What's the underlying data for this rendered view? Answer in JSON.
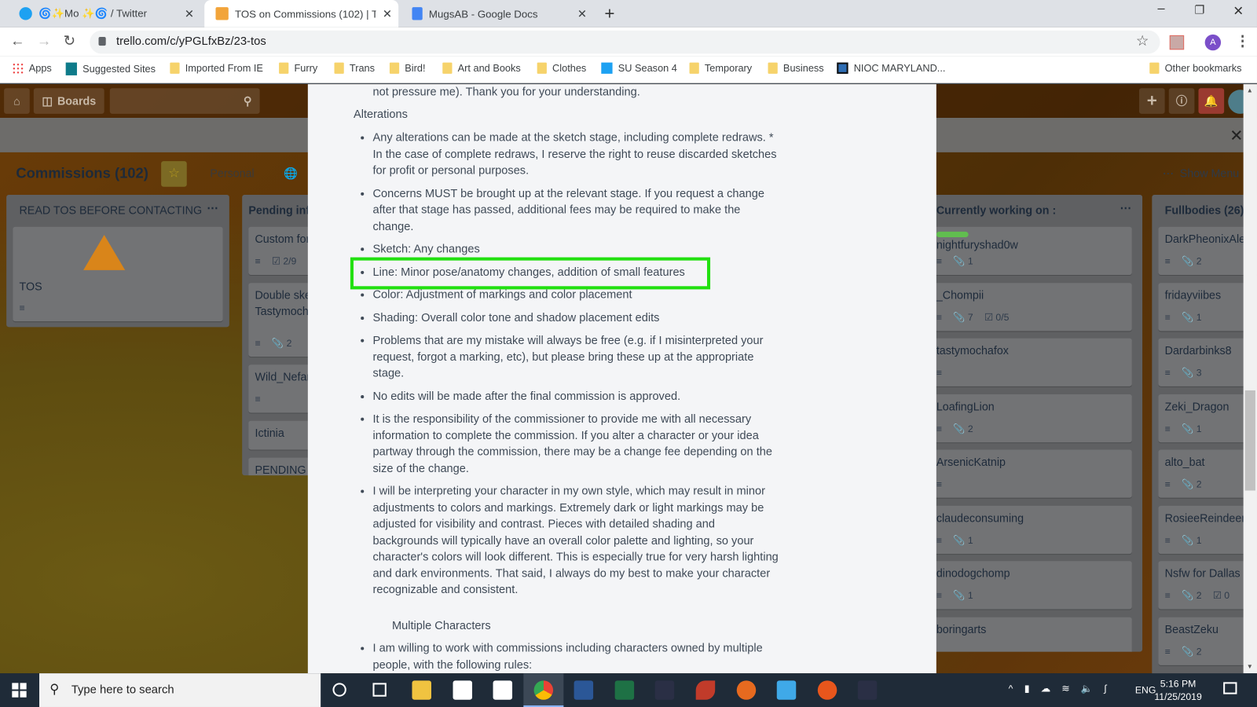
{
  "browser": {
    "tabs": [
      {
        "title": "🌀✨Mo ✨🌀 / Twitter",
        "icon": "twitter-icon"
      },
      {
        "title": "TOS on Commissions (102) | Trello",
        "icon": "trello-icon",
        "active": true
      },
      {
        "title": "MugsAB - Google Docs",
        "icon": "google-docs-icon"
      }
    ],
    "new_tab": "+",
    "close": "✕",
    "url": "trello.com/c/yPGLfxBz/23-tos",
    "profile_initial": "A",
    "bookmarks": [
      "Apps",
      "Suggested Sites",
      "Imported From IE",
      "Furry",
      "Trans",
      "Bird!",
      "Art and Books",
      "Clothes",
      "SU Season 4",
      "Temporary",
      "Business",
      "NIOC MARYLAND..."
    ],
    "other_bookmarks": "Other bookmarks"
  },
  "trello": {
    "boards_label": "Boards",
    "board_title": "Commissions (102)",
    "team": "Personal",
    "show_menu": "Show Menu",
    "lists": [
      {
        "name": "READ TOS BEFORE CONTACTING",
        "cards": [
          {
            "title": "TOS",
            "desc": true
          }
        ]
      },
      {
        "name": "Pending inf",
        "cards": [
          {
            "title": "Custom for",
            "desc": true,
            "check": "2/9"
          },
          {
            "title": "Double sket",
            "title2": "Tastymocha",
            "desc": true,
            "attach": "2"
          },
          {
            "title": "Wild_Nefari",
            "desc": true
          },
          {
            "title": "Ictinia"
          },
          {
            "title": "PENDING C"
          }
        ]
      },
      {
        "name": "Currently working on :",
        "cards": [
          {
            "title": "nightfuryshad0w",
            "desc": true,
            "attach": "1",
            "label": "#61bd4f"
          },
          {
            "title": "_Chompii",
            "desc": true,
            "attach": "7",
            "check": "0/5"
          },
          {
            "title": "tastymochafox",
            "desc": true
          },
          {
            "title": "LoafingLion",
            "desc": true,
            "attach": "2"
          },
          {
            "title": "ArsenicKatnip",
            "desc": true
          },
          {
            "title": "claudeconsuming",
            "desc": true,
            "attach": "1"
          },
          {
            "title": "dinodogchomp",
            "desc": true,
            "attach": "1"
          },
          {
            "title": "boringarts"
          }
        ]
      },
      {
        "name": "Fullbodies (26)",
        "cards": [
          {
            "title": "DarkPheonixAle",
            "desc": true,
            "attach": "2"
          },
          {
            "title": "fridayviibes",
            "desc": true,
            "attach": "1"
          },
          {
            "title": "Dardarbinks8",
            "desc": true,
            "attach": "3"
          },
          {
            "title": "Zeki_Dragon",
            "desc": true,
            "attach": "1"
          },
          {
            "title": "alto_bat",
            "desc": true,
            "attach": "2"
          },
          {
            "title": "RosieeReindeer",
            "desc": true,
            "attach": "1"
          },
          {
            "title": "Nsfw for Dallas",
            "desc": true,
            "attach": "2",
            "check": "0"
          },
          {
            "title": "BeastZeku",
            "desc": true,
            "attach": "2"
          }
        ]
      }
    ]
  },
  "card_modal": {
    "intro_tail": "not pressure me). Thank you for your understanding.",
    "heading": "Alterations",
    "items": [
      "Any alterations can be made at the sketch stage, including complete redraws. * In the case of complete redraws, I reserve the right to reuse discarded sketches for profit or personal purposes.",
      "Concerns MUST be brought up at the relevant stage. If you request a change after that stage has passed, additional fees may be required to make the change.",
      "Sketch: Any changes",
      "Line: Minor pose/anatomy changes, addition of small features",
      "Color: Adjustment of markings and color placement",
      "Shading: Overall color tone and shadow placement edits",
      "Problems that are my mistake will always be free (e.g. if I misinterpreted your request, forgot a marking, etc), but please bring these up at the appropriate stage.",
      "No edits will be made after the final commission is approved.",
      "It is the responsibility of the commissioner to provide me with all necessary information to complete the commission. If you alter a character or your idea partway through the commission, there may be a change fee depending on the size of the change.",
      "I will be interpreting your character in my own style, which may result in minor adjustments to colors and markings. Extremely dark or light markings may be adjusted for visibility and contrast. Pieces with detailed shading and backgrounds will typically have an overall color palette and lighting, so your character's colors will look different. This is especially true for very harsh lighting and dark environments. That said, I always do my best to make your character recognizable and consistent."
    ],
    "heading2": "Multiple Characters",
    "items2": [
      "I am willing to work with commissions including characters owned by multiple people, with the following rules:"
    ],
    "highlight_color": "#22e010"
  },
  "taskbar": {
    "search_placeholder": "Type here to search",
    "time": "5:16 PM",
    "date": "11/25/2019",
    "lang": "ENG"
  }
}
